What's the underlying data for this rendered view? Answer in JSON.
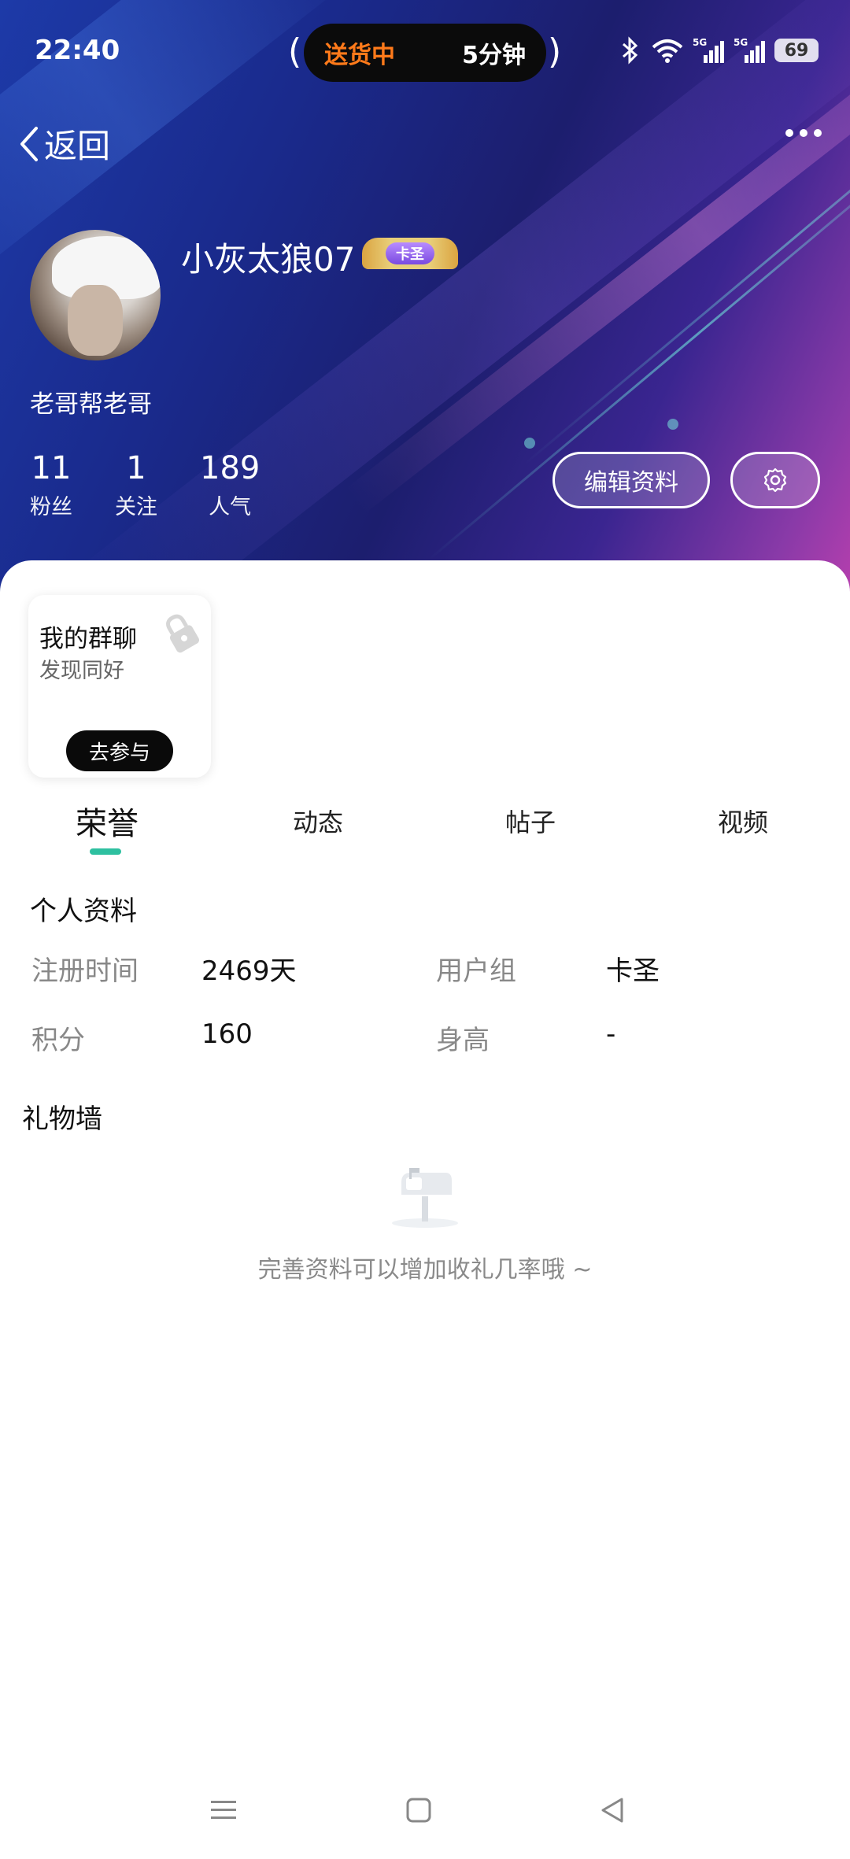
{
  "status_bar": {
    "time": "22:40",
    "live_left": "送货中",
    "live_right": "5分钟",
    "battery": "69"
  },
  "nav": {
    "back_label": "返回"
  },
  "profile": {
    "username": "小灰太狼07",
    "badge": "卡圣",
    "bio": "老哥帮老哥",
    "stats": [
      {
        "value": "11",
        "label": "粉丝"
      },
      {
        "value": "1",
        "label": "关注"
      },
      {
        "value": "189",
        "label": "人气"
      }
    ],
    "edit_label": "编辑资料"
  },
  "group_card": {
    "title": "我的群聊",
    "subtitle": "发现同好",
    "button": "去参与"
  },
  "tabs": [
    "荣誉",
    "动态",
    "帖子",
    "视频"
  ],
  "active_tab": "荣誉",
  "personal_info": {
    "title": "个人资料",
    "fields": [
      {
        "label": "注册时间",
        "value": "2469天"
      },
      {
        "label": "用户组",
        "value": "卡圣"
      },
      {
        "label": "积分",
        "value": "160"
      },
      {
        "label": "身高",
        "value": "-"
      }
    ]
  },
  "gift_wall": {
    "title": "礼物墙",
    "empty_text": "完善资料可以增加收礼几率哦 ~"
  },
  "colors": {
    "accent": "#2ec0a0",
    "live_orange": "#ff7a1a"
  }
}
